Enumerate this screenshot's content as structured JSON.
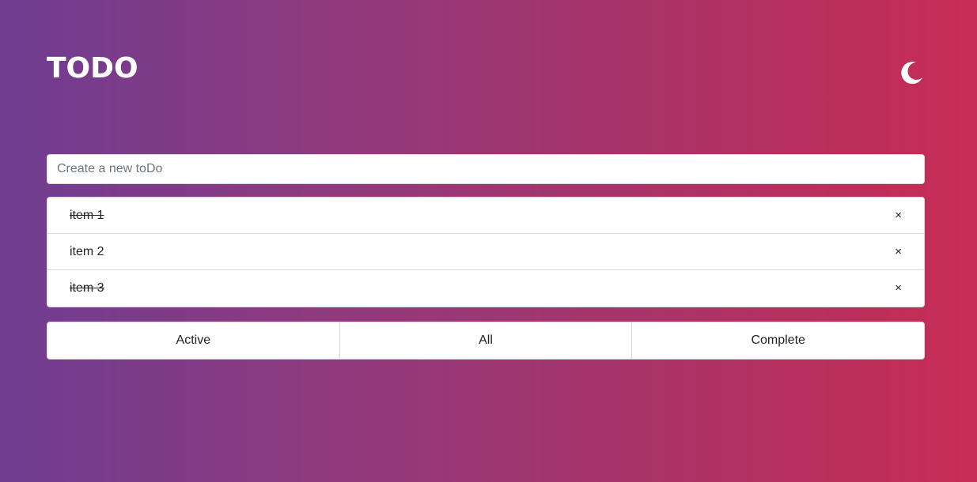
{
  "header": {
    "title": "TODO",
    "theme_icon": "moon-icon"
  },
  "input": {
    "placeholder": "Create a new toDo",
    "value": ""
  },
  "todos": [
    {
      "text": "item 1",
      "completed": true,
      "delete_label": "×"
    },
    {
      "text": "item 2",
      "completed": false,
      "delete_label": "×"
    },
    {
      "text": "item 3",
      "completed": true,
      "delete_label": "×"
    }
  ],
  "filters": [
    {
      "label": "Active"
    },
    {
      "label": "All"
    },
    {
      "label": "Complete"
    }
  ],
  "colors": {
    "gradient_start": "#6f3d91",
    "gradient_end": "#c72c54",
    "surface": "#ffffff",
    "border": "#d9d9d9"
  }
}
